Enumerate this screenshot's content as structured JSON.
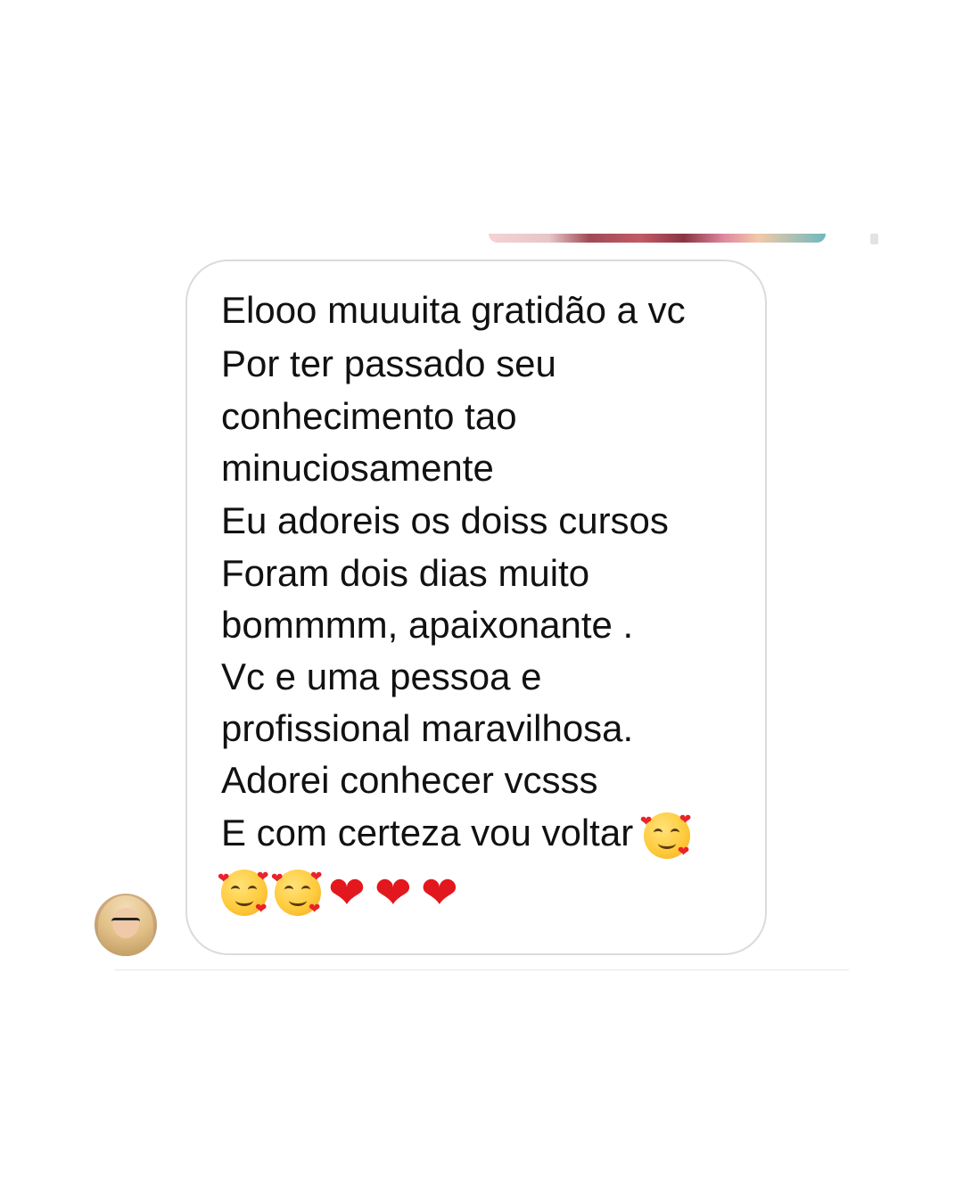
{
  "conversation": {
    "previous_media": {
      "kind": "image-thumbnail"
    },
    "message": {
      "lines": [
        "Elooo muuuita gratidão a vc",
        "Por ter passado seu",
        "conhecimento tao",
        "minuciosamente",
        "Eu adoreis os doiss cursos",
        "Foram dois dias muito",
        "bommmm, apaixonante .",
        "Vc e uma pessoa e",
        "profissional maravilhosa.",
        "Adorei conhecer vcsss",
        "E com certeza vou voltar"
      ],
      "emojis_inline": [
        "smiling-face-with-hearts"
      ],
      "emojis_last_line": [
        "smiling-face-with-hearts",
        "smiling-face-with-hearts",
        "red-heart",
        "red-heart",
        "red-heart"
      ]
    },
    "sender_avatar": {
      "icon": "avatar-photo"
    }
  },
  "colors": {
    "bubble_border": "#dbdbdb",
    "text": "#111111",
    "background": "#ffffff",
    "heart": "#e3171e"
  }
}
